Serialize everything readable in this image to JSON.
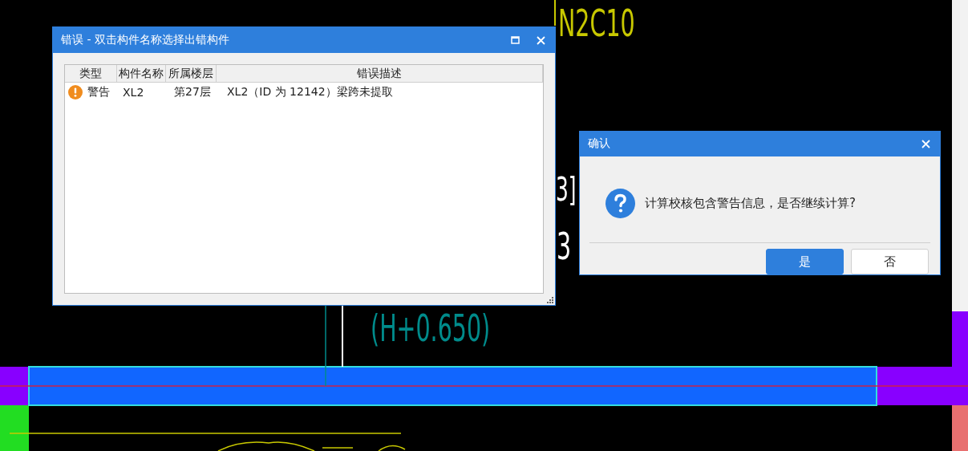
{
  "drawing": {
    "labels": [
      {
        "text": "N2C10",
        "color": "#c8c800"
      },
      {
        "text": "3]",
        "color": "#ffffff"
      },
      {
        "text": "3",
        "color": "#ffffff"
      },
      {
        "text": "(H+0.650)",
        "color": "#008b8b"
      }
    ]
  },
  "error_dialog": {
    "title": "错误 - 双击构件名称选择出错构件",
    "columns": [
      "类型",
      "构件名称",
      "所属楼层",
      "错误描述"
    ],
    "rows": [
      {
        "kind": "warning",
        "type": "警告",
        "name": "XL2",
        "floor": "第27层",
        "description": "XL2（ID 为 12142）梁跨未提取"
      }
    ]
  },
  "confirm_dialog": {
    "title": "确认",
    "message": "计算校核包含警告信息，是否继续计算?",
    "buttons": [
      {
        "label": "是",
        "primary": true
      },
      {
        "label": "否",
        "primary": false
      }
    ]
  }
}
